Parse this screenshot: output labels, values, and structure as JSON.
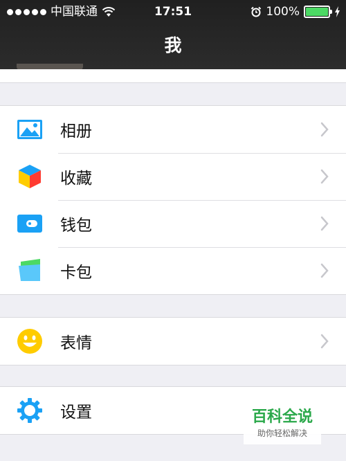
{
  "status": {
    "carrier": "中国联通",
    "time": "17:51",
    "battery": "100%",
    "battery_level": 1.0
  },
  "nav": {
    "title": "我"
  },
  "groups": [
    {
      "items": [
        {
          "label": "相册",
          "icon": "album-icon"
        },
        {
          "label": "收藏",
          "icon": "favorites-cube-icon"
        },
        {
          "label": "钱包",
          "icon": "wallet-icon"
        },
        {
          "label": "卡包",
          "icon": "card-pack-icon"
        }
      ]
    },
    {
      "items": [
        {
          "label": "表情",
          "icon": "smiley-icon"
        }
      ]
    },
    {
      "items": [
        {
          "label": "设置",
          "icon": "gear-icon"
        }
      ]
    }
  ],
  "watermark": {
    "title": "百科全说",
    "subtitle": "助你轻松解决"
  },
  "colors": {
    "accent_blue": "#1aa1f5",
    "battery_green": "#4cd964",
    "smiley_yellow": "#ffcc00",
    "watermark_green": "#2aa84a"
  }
}
